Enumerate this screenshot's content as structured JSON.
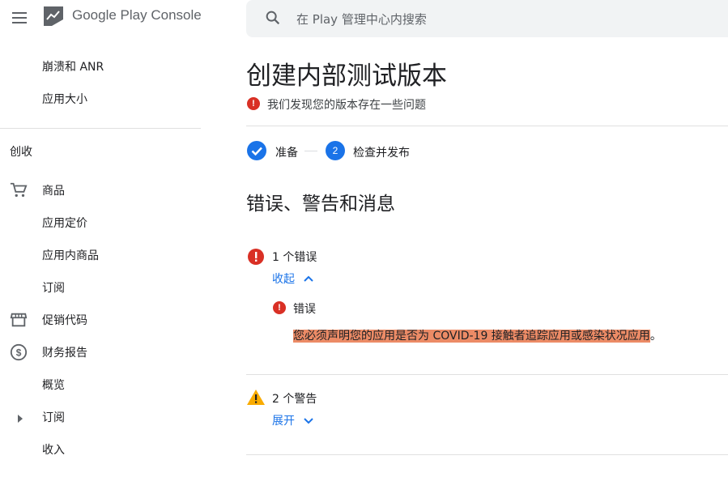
{
  "header": {
    "brand": "Google Play Console",
    "search_placeholder": "在 Play 管理中心内搜索"
  },
  "sidebar": {
    "vitals_items": [
      "崩溃和 ANR",
      "应用大小"
    ],
    "section_title": "创收",
    "items": [
      {
        "label": "商品",
        "icon": "cart-icon"
      },
      {
        "label": "应用定价"
      },
      {
        "label": "应用内商品"
      },
      {
        "label": "订阅"
      },
      {
        "label": "促销代码",
        "icon": "storefront-icon"
      },
      {
        "label": "财务报告",
        "icon": "dollar-circle-icon"
      },
      {
        "label": "概览"
      },
      {
        "label": "订阅",
        "icon": "expand-arrow-icon"
      },
      {
        "label": "收入"
      }
    ]
  },
  "main": {
    "title": "创建内部测试版本",
    "issue_summary": "我们发现您的版本存在一些问题",
    "steps": [
      {
        "label": "准备",
        "state": "done"
      },
      {
        "label": "检查并发布",
        "number": "2",
        "state": "current"
      }
    ],
    "section_title": "错误、警告和消息",
    "errors": {
      "count_label": "1 个错误",
      "toggle_label": "收起",
      "item_title": "错误",
      "item_message": "您必须声明您的应用是否为 COVID-19 接触者追踪应用或感染状况应用",
      "item_message_end": "。"
    },
    "warnings": {
      "count_label": "2 个警告",
      "toggle_label": "展开"
    }
  },
  "colors": {
    "accent": "#1a73e8",
    "error": "#d93025",
    "warning": "#f9ab00",
    "highlight": "#ec8b66"
  }
}
